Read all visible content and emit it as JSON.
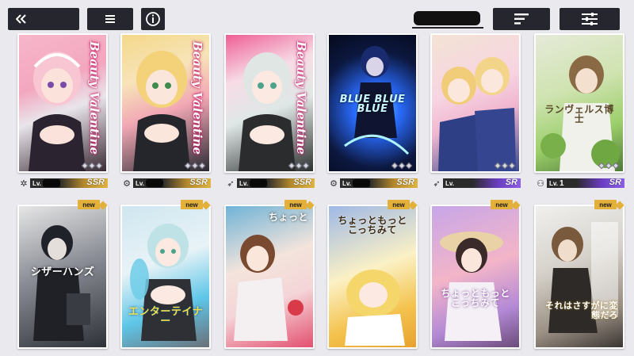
{
  "toolbar": {
    "back_icon": "double-chevron-left-icon",
    "menu_icon": "list-icon",
    "info_icon": "info-icon",
    "sort_icon": "sort-icon",
    "filter_icon": "sliders-icon"
  },
  "cards_row1": [
    {
      "title_vertical": "Beauty Valentine",
      "lv_label": "Lv.",
      "rank": "SSR",
      "rank_tier": "gold",
      "icon": "star-icon",
      "palette": [
        "#f7b6c9",
        "#e86c8d",
        "#3a2b35"
      ]
    },
    {
      "title_vertical": "Beauty Valentine",
      "lv_label": "Lv.",
      "rank": "SSR",
      "rank_tier": "gold",
      "icon": "gear-icon",
      "palette": [
        "#f4d88a",
        "#f2a8b5",
        "#2a2a32"
      ]
    },
    {
      "title_vertical": "Beauty Valentine",
      "lv_label": "Lv.",
      "rank": "SSR",
      "rank_tier": "gold",
      "icon": "feather-icon",
      "palette": [
        "#dfe7e6",
        "#ef5f95",
        "#2d3030"
      ]
    },
    {
      "title_overlay": "BLUE BLUE BLUE",
      "lv_label": "Lv.",
      "rank": "SSR",
      "rank_tier": "gold",
      "icon": "gear-icon",
      "palette": [
        "#0c1840",
        "#2a6cff",
        "#7ee6ff"
      ]
    },
    {
      "lv_label": "Lv.",
      "rank": "SR",
      "rank_tier": "purple",
      "icon": "feather-icon",
      "palette": [
        "#f3e3d4",
        "#f0b6cf",
        "#3b4a8c"
      ]
    },
    {
      "title_overlay": "ランヴェルス博士",
      "lv_label": "Lv.",
      "lv_number": "1",
      "rank": "SR",
      "rank_tier": "purple",
      "icon": "mask-icon",
      "palette": [
        "#e6ead9",
        "#9ccf6c",
        "#6a5a3e"
      ]
    }
  ],
  "cards_row2": [
    {
      "title_overlay": "シザーハンズ",
      "new_label": "new",
      "palette": [
        "#2f3138",
        "#8b8e96",
        "#e6e6e6"
      ]
    },
    {
      "title_overlay": "エンターテイナー",
      "new_label": "new",
      "palette": [
        "#cfe6f0",
        "#5fc6e8",
        "#6a6f77"
      ]
    },
    {
      "title_overlay": "ちょっと",
      "new_label": "new",
      "palette": [
        "#f3e4dc",
        "#e35070",
        "#6fb3d7"
      ]
    },
    {
      "title_overlay": "ちょっともっとこっちみて",
      "new_label": "new",
      "palette": [
        "#fbf1c5",
        "#f4c34e",
        "#9fb8e6"
      ]
    },
    {
      "title_overlay": "ちょっともっとこっちみて",
      "new_label": "new",
      "palette": [
        "#c7a6e8",
        "#f3b5c8",
        "#6b4b7a"
      ]
    },
    {
      "title_overlay": "それはさすがに変態だろ",
      "new_label": "new",
      "palette": [
        "#f0f0ee",
        "#9a8f83",
        "#3b3633"
      ]
    }
  ]
}
